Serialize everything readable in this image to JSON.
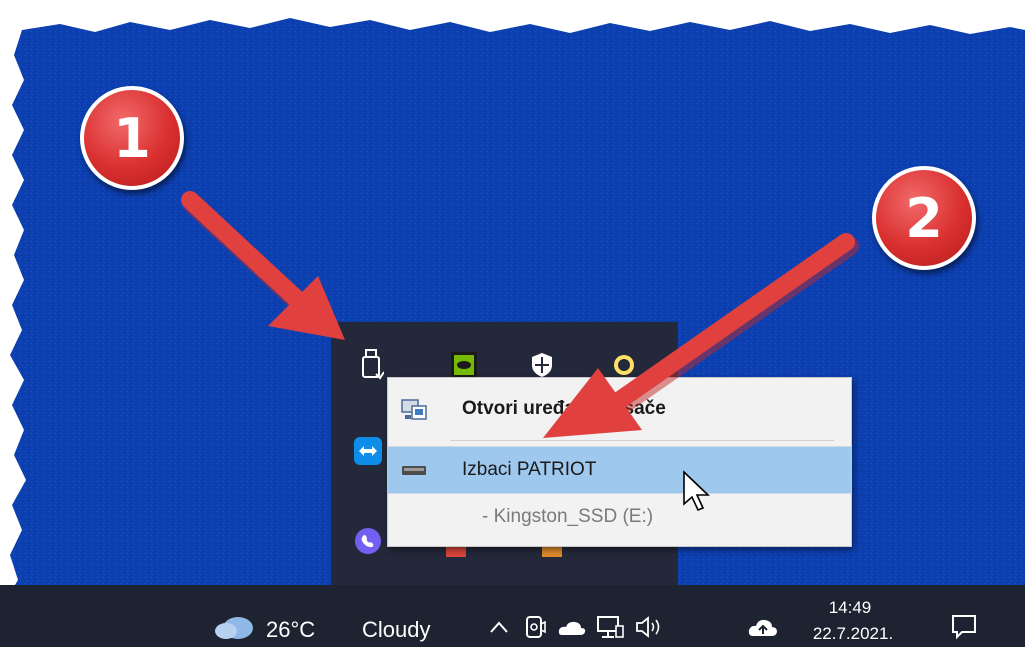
{
  "context_menu": {
    "items": [
      {
        "label": "Otvori uređaje i pisače"
      },
      {
        "label": "Izbaci PATRIOT"
      },
      {
        "label": "- Kingston_SSD (E:)"
      }
    ]
  },
  "taskbar": {
    "weather_temp": "26°C",
    "weather_condition": "Cloudy",
    "clock_time": "14:49",
    "clock_date": "22.7.2021."
  },
  "annotations": {
    "badge_1": "1",
    "badge_2": "2"
  },
  "colors": {
    "desktop_blue": "#0c3fb0",
    "taskbar": "#1d2330",
    "tray_popup": "#23293a",
    "menu_highlight": "#9fc8ef",
    "annotation_red": "#e0403e"
  },
  "icons": {
    "tray": [
      "usb-drive-icon",
      "nvidia-icon",
      "windows-security-icon",
      "shield-icon",
      "teamviewer-icon",
      "viber-icon"
    ],
    "taskbar": [
      "weather-cloud-icon",
      "chevron-up-icon",
      "meet-now-icon",
      "onedrive-icon",
      "network-icon",
      "volume-icon",
      "cloud-upload-icon",
      "notification-icon"
    ]
  }
}
